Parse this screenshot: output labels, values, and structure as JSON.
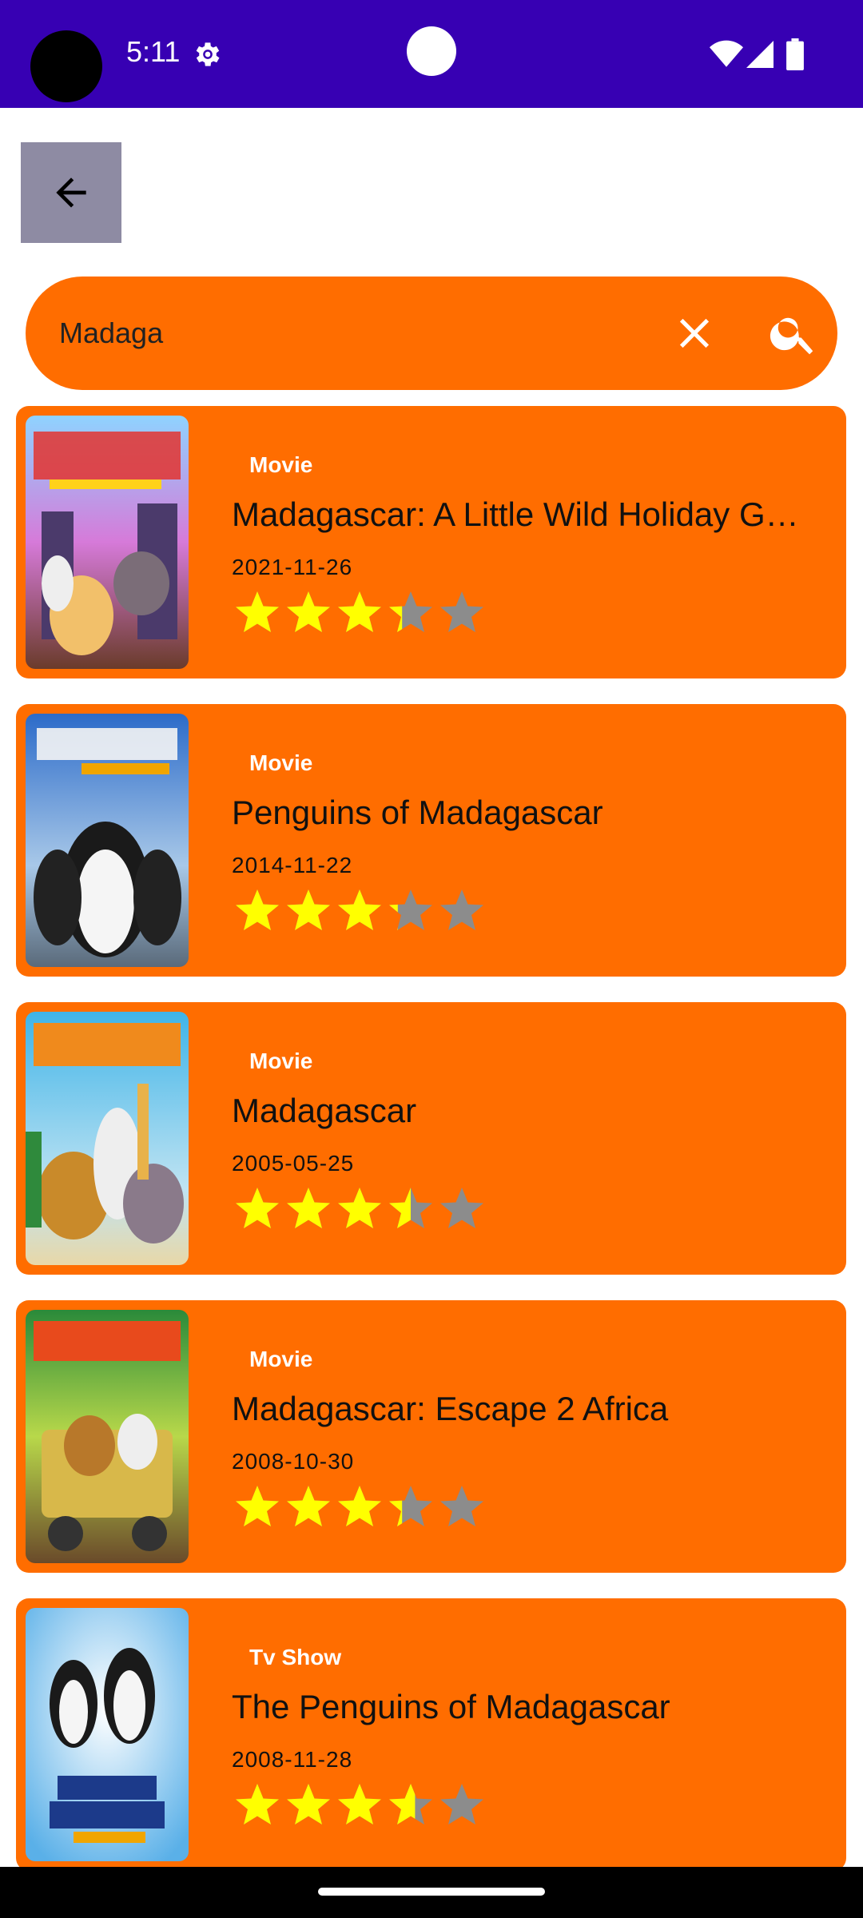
{
  "status_bar": {
    "time": "5:11",
    "icons": [
      "gear-icon",
      "wifi-icon",
      "signal-icon",
      "battery-icon"
    ]
  },
  "toolbar": {
    "back_icon": "arrow-left-icon"
  },
  "search": {
    "value": "Madaga",
    "placeholder": "",
    "clear_icon": "close-icon",
    "search_icon": "search-icon"
  },
  "colors": {
    "status_bar": "#3700b3",
    "accent": "#ff6d00",
    "back_button": "#8e8ba3",
    "star_filled": "#ffff00",
    "star_empty": "#8c8c8c"
  },
  "results": [
    {
      "type": "Movie",
      "title": "Madagascar: A Little Wild Holiday G…",
      "date": "2021-11-26",
      "rating_stars": 3.3,
      "rating_max": 5
    },
    {
      "type": "Movie",
      "title": "Penguins of Madagascar",
      "date": "2014-11-22",
      "rating_stars": 3.2,
      "rating_max": 5
    },
    {
      "type": "Movie",
      "title": "Madagascar",
      "date": "2005-05-25",
      "rating_stars": 3.5,
      "rating_max": 5
    },
    {
      "type": "Movie",
      "title": "Madagascar: Escape 2 Africa",
      "date": "2008-10-30",
      "rating_stars": 3.3,
      "rating_max": 5
    },
    {
      "type": "Tv Show",
      "title": "The Penguins of Madagascar",
      "date": "2008-11-28",
      "rating_stars": 3.6,
      "rating_max": 5
    }
  ]
}
